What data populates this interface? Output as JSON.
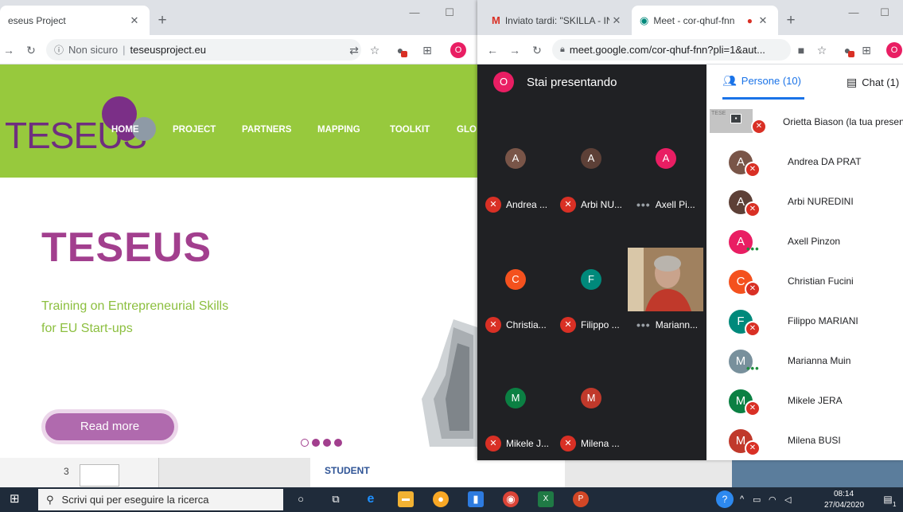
{
  "left_window": {
    "tab_title": "eseus Project",
    "new_tab": "+",
    "omnibox": {
      "security": "Non sicuro",
      "separator": "|",
      "url": "teseusproject.eu"
    },
    "profile_initial": "O"
  },
  "site": {
    "logo": "TESEUS",
    "nav": [
      "HOME",
      "PROJECT",
      "PARTNERS",
      "MAPPING",
      "TOOLKIT",
      "GLO"
    ],
    "hero_title": "TESEUS",
    "hero_sub_1": "Training on Entrepreneurial Skills",
    "hero_sub_2": "for EU Start-ups",
    "read_more": "Read more"
  },
  "strip": {
    "slide_number": "3",
    "student_label": "STUDENT"
  },
  "right_window": {
    "tabs": [
      {
        "title": "Inviato tardi: \"SKILLA - INTE",
        "icon": "gmail-icon"
      },
      {
        "title": "Meet - cor-qhuf-fnn",
        "icon": "meet-icon"
      }
    ],
    "new_tab": "+",
    "url": "meet.google.com/cor-qhuf-fnn?pli=1&aut...",
    "profile_initial": "O"
  },
  "meet": {
    "presenting_initial": "O",
    "presenting_text": "Stai presentando",
    "tiles": [
      {
        "initial": "A",
        "color": "#795548",
        "name": "Andrea ...",
        "muted": true
      },
      {
        "initial": "A",
        "color": "#5d4037",
        "name": "Arbi NU...",
        "muted": true
      },
      {
        "initial": "A",
        "color": "#e91e63",
        "name": "Axell Pi...",
        "muted": false
      },
      {
        "initial": "C",
        "color": "#f4511e",
        "name": "Christia...",
        "muted": true
      },
      {
        "initial": "F",
        "color": "#00897b",
        "name": "Filippo ...",
        "muted": true
      },
      {
        "initial": "",
        "color": "#6d5b49",
        "name": "Mariann...",
        "muted": false
      },
      {
        "initial": "M",
        "color": "#0b8043",
        "name": "Mikele J...",
        "muted": true
      },
      {
        "initial": "M",
        "color": "#c0392b",
        "name": "Milena ...",
        "muted": true
      }
    ]
  },
  "people_panel": {
    "people_tab": "Persone (10)",
    "chat_tab": "Chat (1)",
    "presenter_thumb_text": "TESE",
    "participants": [
      {
        "initial": "",
        "color": "#9aa0a6",
        "name": "Orietta Biason (la tua presentazione)",
        "status": "muted"
      },
      {
        "initial": "A",
        "color": "#795548",
        "name": "Andrea DA PRAT",
        "status": "muted"
      },
      {
        "initial": "A",
        "color": "#5d4037",
        "name": "Arbi NUREDINI",
        "status": "muted"
      },
      {
        "initial": "A",
        "color": "#e91e63",
        "name": "Axell Pinzon",
        "status": "talking"
      },
      {
        "initial": "C",
        "color": "#f4511e",
        "name": "Christian Fucini",
        "status": "muted"
      },
      {
        "initial": "F",
        "color": "#00897b",
        "name": "Filippo MARIANI",
        "status": "muted"
      },
      {
        "initial": "M",
        "color": "#78909c",
        "name": "Marianna Muin",
        "status": "talking"
      },
      {
        "initial": "M",
        "color": "#0b8043",
        "name": "Mikele JERA",
        "status": "muted"
      },
      {
        "initial": "M",
        "color": "#c0392b",
        "name": "Milena BUSI",
        "status": "muted"
      }
    ]
  },
  "taskbar": {
    "search_placeholder": "Scrivi qui per eseguire la ricerca",
    "time": "08:14",
    "date": "27/04/2020",
    "notification_count": "1"
  }
}
